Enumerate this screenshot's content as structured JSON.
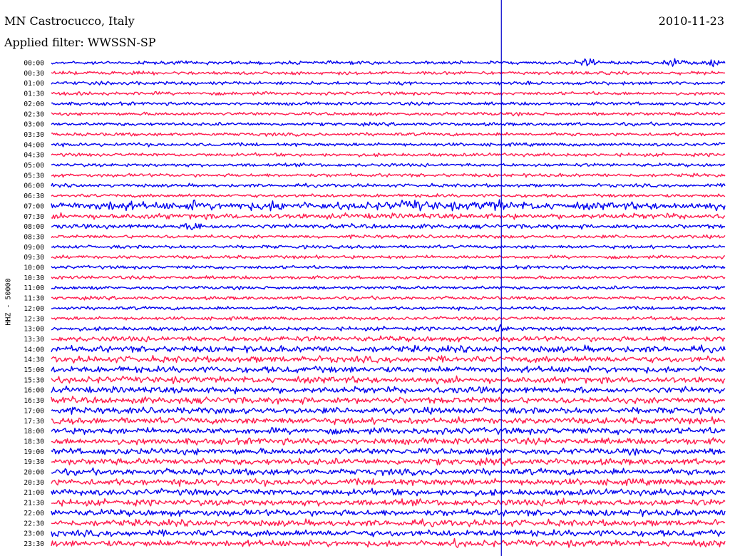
{
  "header": {
    "station": "MN Castrocucco, Italy",
    "date": "2010-11-23",
    "filter": "Applied filter: WWSSN-SP"
  },
  "chart_data": {
    "type": "line",
    "plot_kind": "helicorder (seismogram drum plot)",
    "ylabel": "HHZ - 50000",
    "row_labels": [
      "00:00",
      "00:30",
      "01:00",
      "01:30",
      "02:00",
      "02:30",
      "03:00",
      "03:30",
      "04:00",
      "04:30",
      "05:00",
      "05:30",
      "06:00",
      "06:30",
      "07:00",
      "07:30",
      "08:00",
      "08:30",
      "09:00",
      "09:30",
      "10:00",
      "10:30",
      "11:00",
      "11:30",
      "12:00",
      "12:30",
      "13:00",
      "13:30",
      "14:00",
      "14:30",
      "15:00",
      "15:30",
      "16:00",
      "16:30",
      "17:00",
      "17:30",
      "18:00",
      "18:30",
      "19:00",
      "19:30",
      "20:00",
      "20:30",
      "21:00",
      "21:30",
      "22:00",
      "22:30",
      "23:00",
      "23:30"
    ],
    "row_minutes": 30,
    "series_colors": [
      "#0000ee",
      "#ff1a4d"
    ],
    "cursor_fraction": 0.668,
    "relative_noise_levels": [
      1,
      1,
      1,
      1,
      1,
      1,
      1,
      1,
      1,
      1,
      1,
      1,
      1,
      1,
      2.2,
      1.6,
      1.3,
      1,
      1,
      1,
      1,
      1,
      1,
      1,
      1,
      1,
      1.2,
      1.6,
      1.9,
      1.9,
      1.9,
      1.9,
      1.9,
      1.9,
      1.9,
      1.9,
      1.9,
      1.9,
      1.9,
      1.9,
      1.9,
      1.9,
      1.9,
      1.9,
      1.9,
      1.9,
      1.9,
      1.9
    ],
    "events": [
      {
        "row": 0,
        "x": 0.795,
        "amp": 5.0,
        "width": 0.006
      },
      {
        "row": 0,
        "x": 0.922,
        "amp": 2.0,
        "width": 0.012
      },
      {
        "row": 0,
        "x": 0.98,
        "amp": 1.8,
        "width": 0.008
      },
      {
        "row": 14,
        "x": 0.1,
        "amp": 1.4,
        "width": 0.02
      },
      {
        "row": 14,
        "x": 0.215,
        "amp": 1.6,
        "width": 0.01
      },
      {
        "row": 14,
        "x": 0.33,
        "amp": 1.5,
        "width": 0.02
      },
      {
        "row": 14,
        "x": 0.54,
        "amp": 1.6,
        "width": 0.025
      },
      {
        "row": 14,
        "x": 0.66,
        "amp": 1.6,
        "width": 0.02
      },
      {
        "row": 16,
        "x": 0.215,
        "amp": 2.5,
        "width": 0.01
      },
      {
        "row": 26,
        "x": 0.668,
        "amp": 4.0,
        "width": 0.004
      },
      {
        "row": 26,
        "x": 0.76,
        "amp": 1.5,
        "width": 0.004
      },
      {
        "row": 43,
        "x": 0.76,
        "amp": 1.8,
        "width": 0.004
      },
      {
        "row": 47,
        "x": 0.6,
        "amp": 1.4,
        "width": 0.004
      }
    ]
  }
}
